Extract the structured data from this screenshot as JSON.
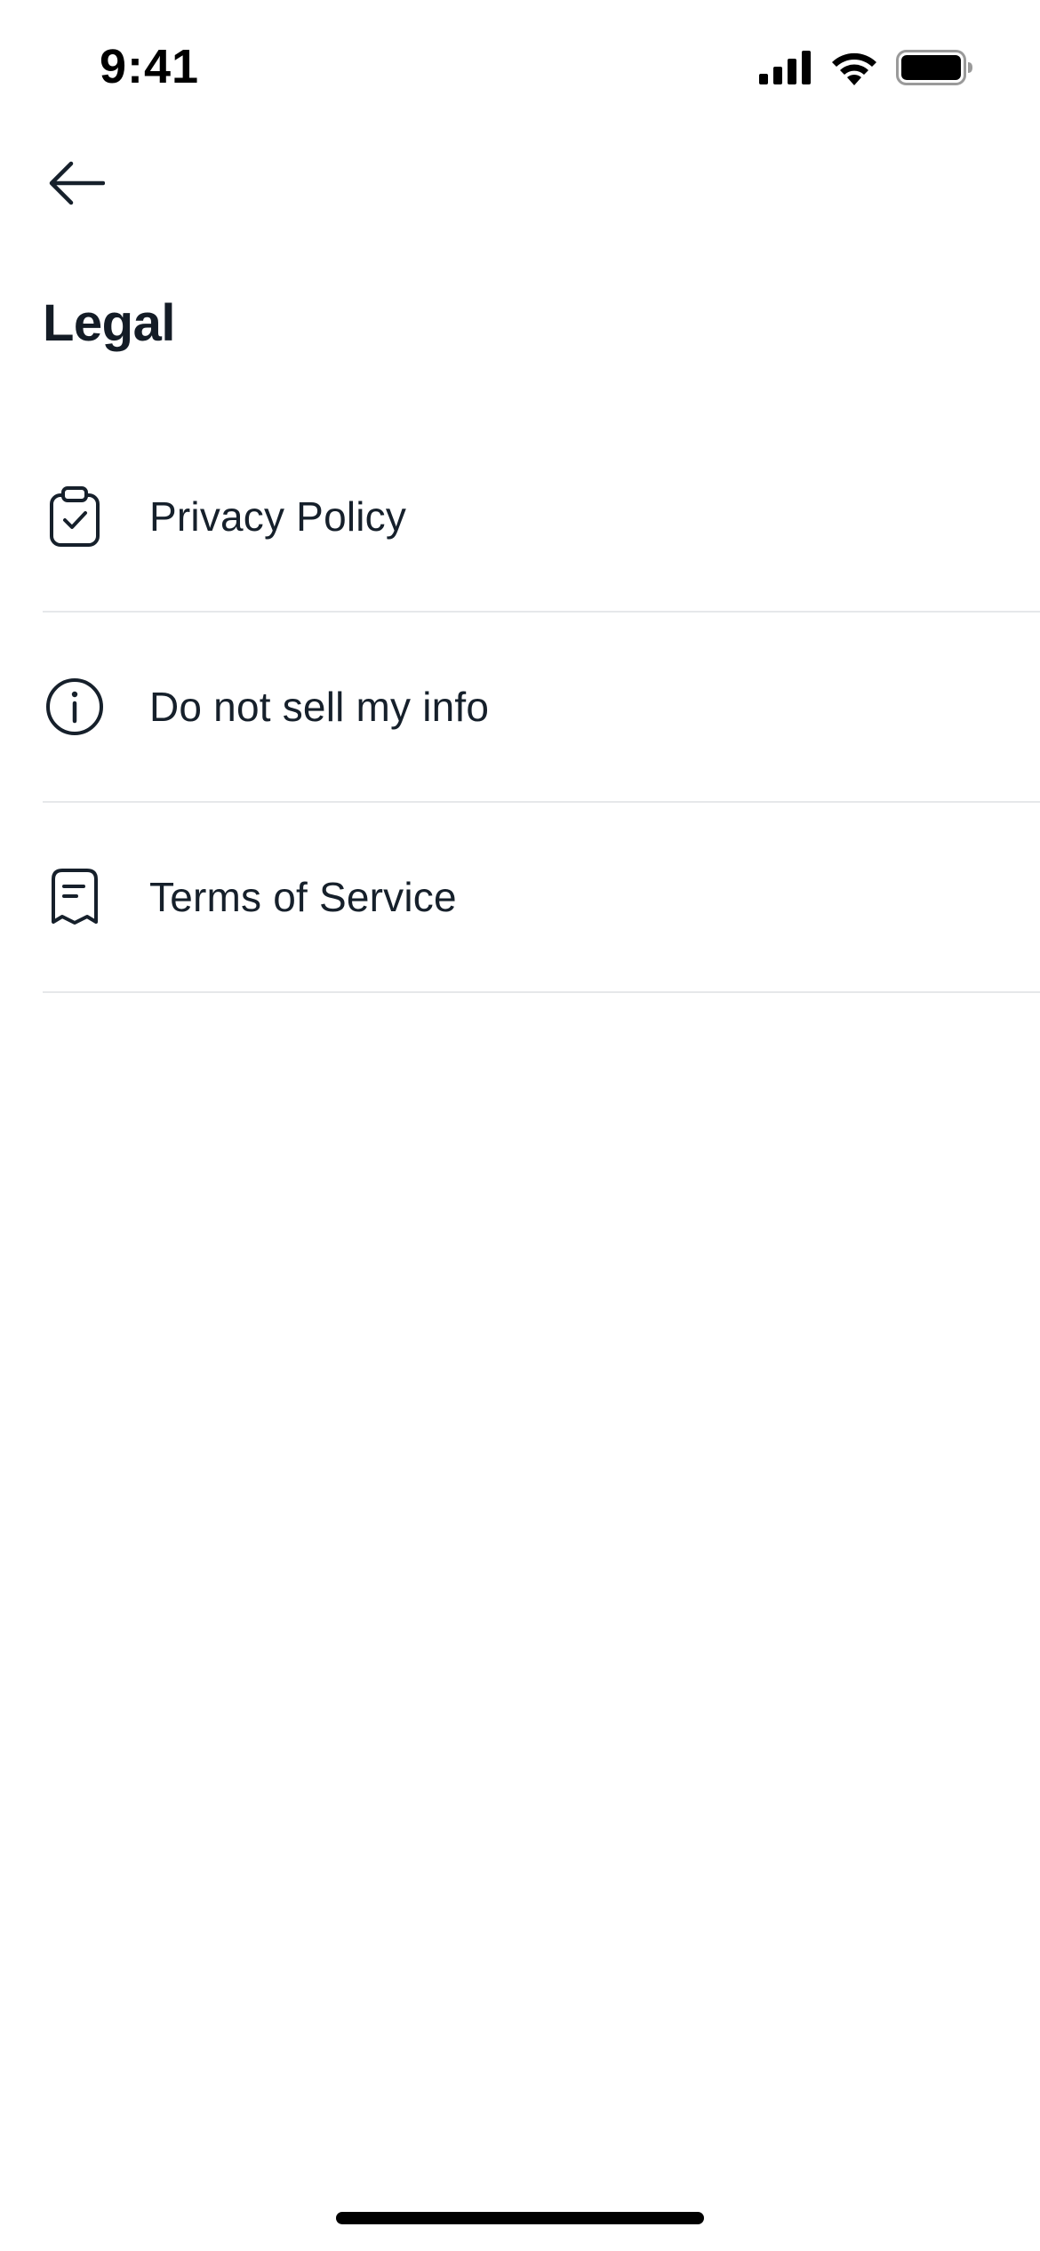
{
  "status_bar": {
    "time": "9:41",
    "icons": [
      "signal-icon",
      "wifi-icon",
      "battery-icon"
    ]
  },
  "header": {
    "back_icon": "arrow-left-icon",
    "title": "Legal"
  },
  "legal_items": [
    {
      "label": "Privacy Policy",
      "icon": "clipboard-check-icon"
    },
    {
      "label": "Do not sell my info",
      "icon": "info-circle-icon"
    },
    {
      "label": "Terms of Service",
      "icon": "receipt-icon"
    }
  ],
  "colors": {
    "text": "#16202b",
    "divider": "#e6e8ea",
    "background": "#ffffff"
  }
}
